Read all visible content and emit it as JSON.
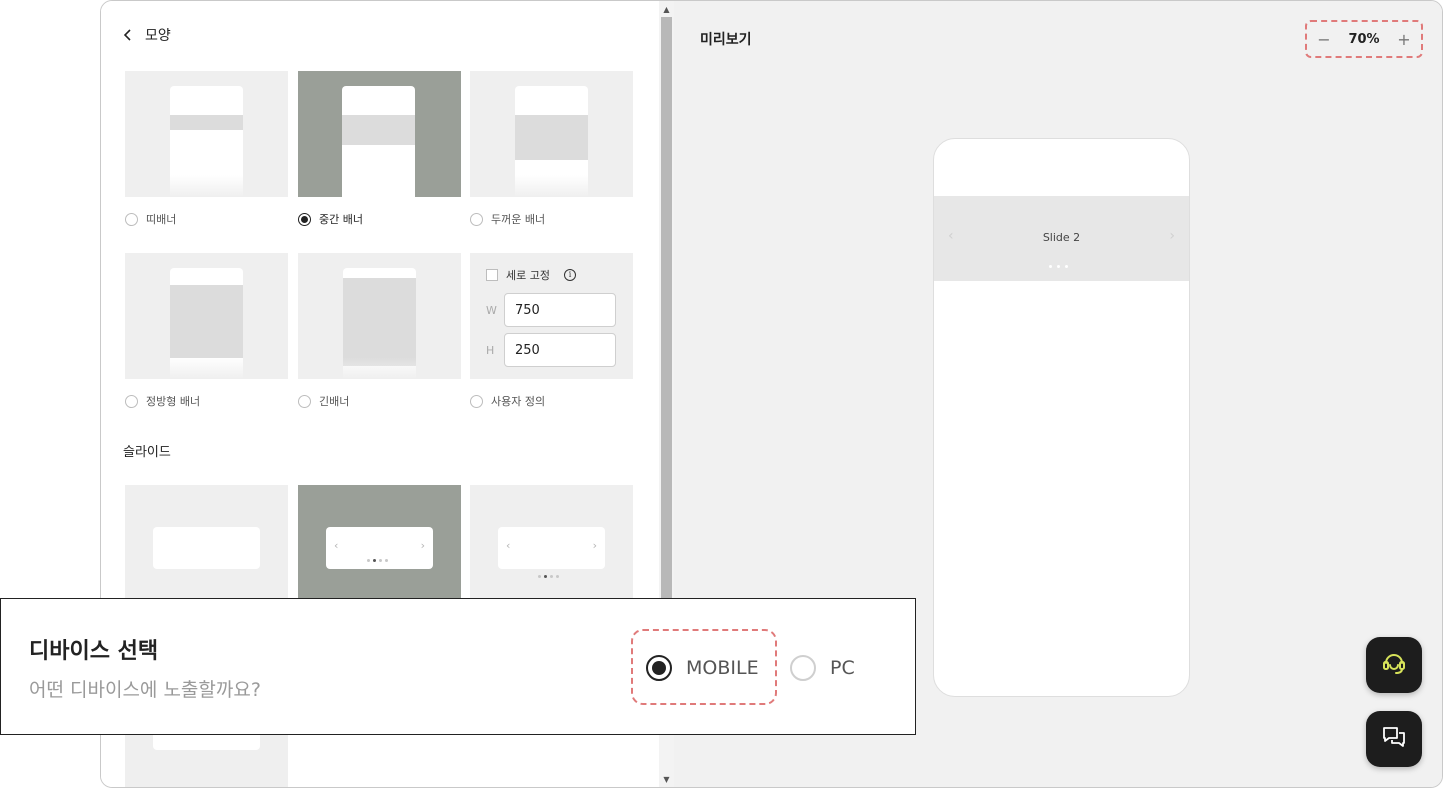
{
  "left_panel": {
    "back_label": "모양",
    "shape_options": [
      {
        "label": "띠배너",
        "selected": false
      },
      {
        "label": "중간 배너",
        "selected": true
      },
      {
        "label": "두꺼운 배너",
        "selected": false
      },
      {
        "label": "정방형 배너",
        "selected": false
      },
      {
        "label": "긴배너",
        "selected": false
      },
      {
        "label": "사용자 정의",
        "selected": false
      }
    ],
    "custom": {
      "fix_height_label": "세로 고정",
      "info_glyph": "i",
      "width_letter": "W",
      "width_value": "750",
      "height_letter": "H",
      "height_value": "250"
    },
    "slide_section_title": "슬라이드",
    "slide_chevron_left": "‹",
    "slide_chevron_right": "›",
    "scroll_up": "▲",
    "scroll_down": "▼"
  },
  "preview": {
    "title": "미리보기",
    "zoom_minus": "−",
    "zoom_value": "70%",
    "zoom_plus": "+",
    "slide_caption": "Slide 2",
    "chevron_left": "‹",
    "chevron_right": "›"
  },
  "device_select": {
    "title": "디바이스 선택",
    "subtitle": "어떤 디바이스에 노출할까요?",
    "options": [
      {
        "label": "MOBILE",
        "selected": true
      },
      {
        "label": "PC",
        "selected": false
      }
    ]
  },
  "colors": {
    "selected_tile": "#9a9f98",
    "highlight_dash": "#e07a7a",
    "fab_bg": "#1d1d1d",
    "fab_icon": "#d7e35a"
  },
  "icons": {
    "back": "chevron-left-icon",
    "support": "headset-icon",
    "chat": "chat-bubbles-icon"
  }
}
